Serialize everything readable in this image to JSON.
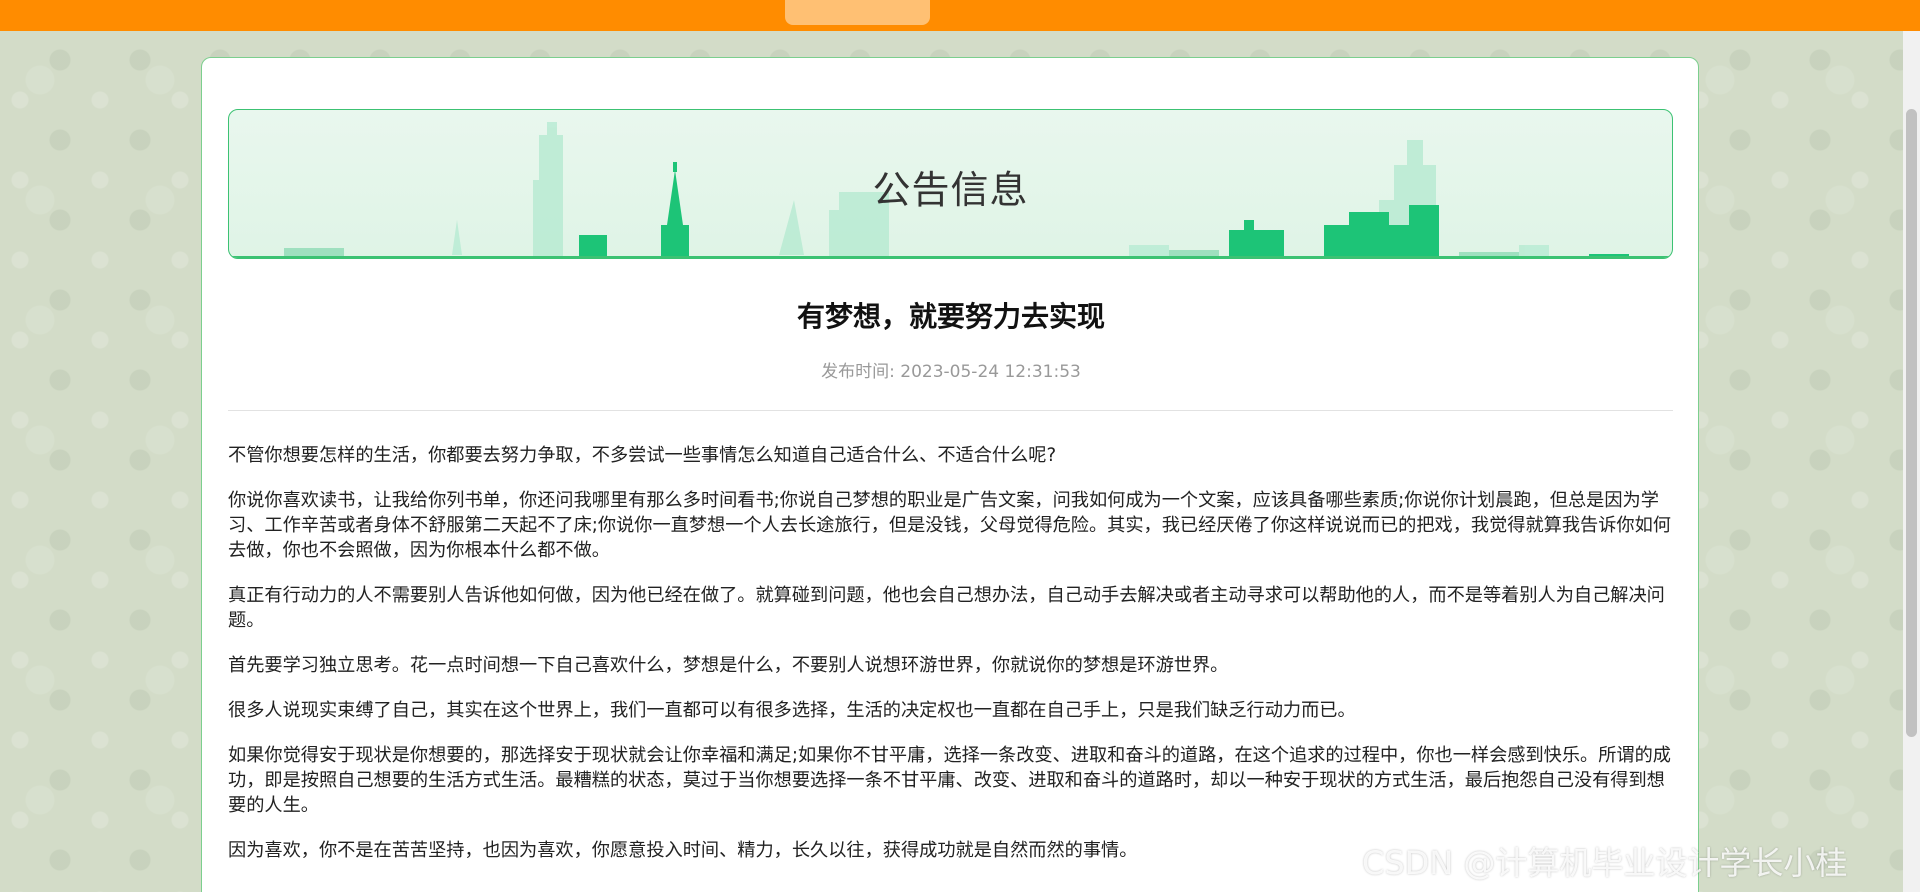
{
  "announcement": {
    "banner_title": "公告信息",
    "title": "有梦想，就要努力去实现",
    "published_label": "发布时间:",
    "published_at": "2023-05-24 12:31:53",
    "paragraphs": [
      "不管你想要怎样的生活，你都要去努力争取，不多尝试一些事情怎么知道自己适合什么、不适合什么呢?",
      "你说你喜欢读书，让我给你列书单，你还问我哪里有那么多时间看书;你说自己梦想的职业是广告文案，问我如何成为一个文案，应该具备哪些素质;你说你计划晨跑，但总是因为学习、工作辛苦或者身体不舒服第二天起不了床;你说你一直梦想一个人去长途旅行，但是没钱，父母觉得危险。其实，我已经厌倦了你这样说说而已的把戏，我觉得就算我告诉你如何去做，你也不会照做，因为你根本什么都不做。",
      "真正有行动力的人不需要别人告诉他如何做，因为他已经在做了。就算碰到问题，他也会自己想办法，自己动手去解决或者主动寻求可以帮助他的人，而不是等着别人为自己解决问题。",
      "首先要学习独立思考。花一点时间想一下自己喜欢什么，梦想是什么，不要别人说想环游世界，你就说你的梦想是环游世界。",
      "很多人说现实束缚了自己，其实在这个世界上，我们一直都可以有很多选择，生活的决定权也一直都在自己手上，只是我们缺乏行动力而已。",
      "如果你觉得安于现状是你想要的，那选择安于现状就会让你幸福和满足;如果你不甘平庸，选择一条改变、进取和奋斗的道路，在这个追求的过程中，你也一样会感到快乐。所谓的成功，即是按照自己想要的生活方式生活。最糟糕的状态，莫过于当你想要选择一条不甘平庸、改变、进取和奋斗的道路时，却以一种安于现状的方式生活，最后抱怨自己没有得到想要的人生。",
      "因为喜欢，你不是在苦苦坚持，也因为喜欢，你愿意投入时间、精力，长久以往，获得成功就是自然而然的事情。"
    ]
  },
  "watermark": "CSDN @计算机毕业设计学长小桂",
  "colors": {
    "nav_bg": "#ff8c00",
    "accent_green": "#1dc477",
    "banner_border": "#3cc273"
  }
}
